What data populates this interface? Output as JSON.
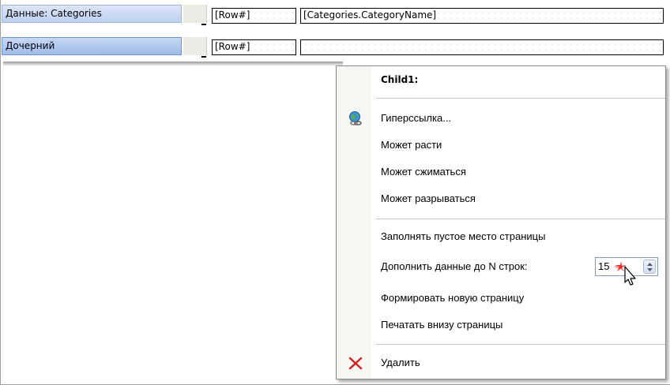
{
  "bands": [
    {
      "label": "Данные: Categories"
    },
    {
      "label": "Дочерний"
    }
  ],
  "cells": {
    "row1_a": "[Row#]",
    "row1_b": "[Categories.CategoryName]",
    "row2_a": "[Row#]",
    "row2_b": ""
  },
  "menu": {
    "header": "Child1:",
    "hyperlink": "Гиперссылка...",
    "can_grow": "Может расти",
    "can_shrink": "Может сжиматься",
    "can_break": "Может разрываться",
    "fill_empty": "Заполнять пустое место страницы",
    "fill_rows": "Дополнить данные до N строк:",
    "fill_rows_value": "15",
    "new_page": "Формировать новую страницу",
    "print_bottom": "Печатать внизу страницы",
    "delete": "Удалить"
  },
  "icons": {
    "hyperlink": "globe-link-icon",
    "delete": "delete-x-icon"
  },
  "colors": {
    "band_bg": "#bcd0ef",
    "band_selected_bg": "#9ebce8",
    "delete_red": "#d42020",
    "cursor_star": "#ff2020"
  }
}
